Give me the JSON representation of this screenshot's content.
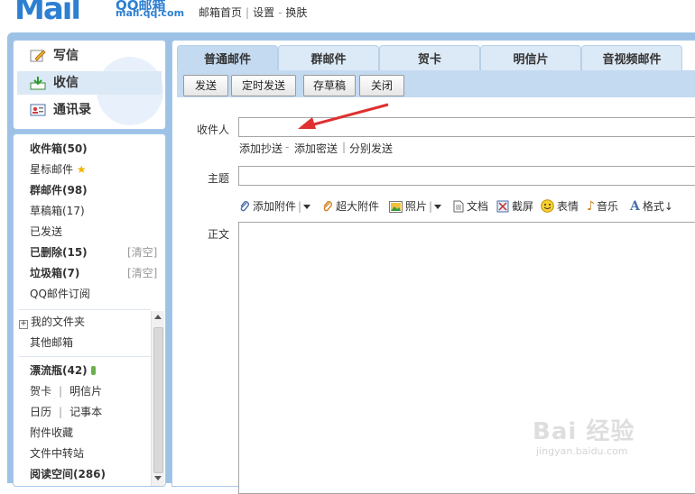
{
  "header": {
    "logo_mark": "Mail",
    "logo_title": "QQ邮箱",
    "logo_domain": "mail.qq.com",
    "links": [
      "邮箱首页",
      "设置",
      "换肤"
    ]
  },
  "left_nav": [
    {
      "label": "写信",
      "icon": "pencil-icon"
    },
    {
      "label": "收信",
      "icon": "inbox-icon"
    },
    {
      "label": "通讯录",
      "icon": "contacts-icon"
    }
  ],
  "folders": {
    "inbox": "收件箱(50)",
    "starred": "星标邮件",
    "group": "群邮件(98)",
    "drafts": "草稿箱(17)",
    "sent": "已发送",
    "deleted": "已删除(15)",
    "deleted_clear": "[清空]",
    "spam": "垃圾箱(7)",
    "spam_clear": "[清空]",
    "subscribe": "QQ邮件订阅",
    "my_folders": "我的文件夹",
    "other_mail": "其他邮箱",
    "drift_bottle": "漂流瓶(42)",
    "card": "贺卡",
    "postcard": "明信片",
    "calendar": "日历",
    "notes": "记事本",
    "attachments": "附件收藏",
    "transfer": "文件中转站",
    "reading": "阅读空间(286)"
  },
  "tabs": [
    "普通邮件",
    "群邮件",
    "贺卡",
    "明信片",
    "音视频邮件"
  ],
  "toolbar": {
    "send": "发送",
    "schedule": "定时发送",
    "draft": "存草稿",
    "close": "关闭"
  },
  "compose": {
    "to_label": "收件人",
    "add_cc": "添加抄送",
    "dash": "-",
    "add_bcc": "添加密送",
    "pipe": "|",
    "separate_send": "分别发送",
    "subject_label": "主题",
    "body_label": "正文"
  },
  "editor_tools": {
    "attach": "添加附件",
    "big_attach": "超大附件",
    "photo": "照片",
    "doc": "文档",
    "screenshot": "截屏",
    "emoji": "表情",
    "music": "音乐",
    "format": "格式↓"
  },
  "watermark": {
    "brand": "Bai 经验",
    "url": "jingyan.baidu.com"
  },
  "colors": {
    "accent": "#2d7fd2",
    "frame": "#9dc2e6",
    "tab_selected": "#c3daf1",
    "arrow": "#e03030"
  }
}
